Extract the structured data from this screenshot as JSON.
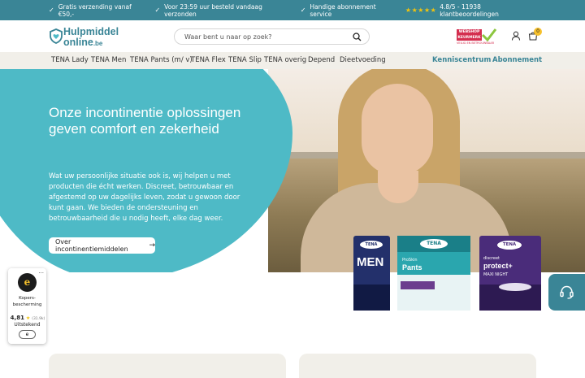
{
  "topbar": {
    "usps": [
      "Gratis verzending vanaf €50,-",
      "Voor 23:59 uur besteld vandaag verzonden",
      "Handige abonnement service"
    ],
    "stars": "★★★★★",
    "rating": "4.8/5 - 11938 klantbeoordelingen"
  },
  "header": {
    "logo_line1": "Hulpmiddel",
    "logo_line2": "online",
    "logo_tld": ".be",
    "search_placeholder": "Waar bent u naar op zoek?",
    "keurmerk_line1": "WEBSHOP",
    "keurmerk_line2": "KEURMERK",
    "keurmerk_sub": "VEILIG EN BETROUWBAAR",
    "cart_count": "0"
  },
  "nav": {
    "items": [
      "TENA Lady",
      "TENA Men",
      "TENA Pants (m/ v)",
      "TENA Flex",
      "TENA Slip",
      "TENA overig",
      "Depend",
      "Dieetvoeding"
    ],
    "right": [
      "Kenniscentrum",
      "Abonnement"
    ]
  },
  "hero": {
    "title": "Onze incontinentie oplossingen geven comfort en zekerheid",
    "text": "Wat uw persoonlijke situatie ook is, wij helpen u met producten die écht werken. Discreet, betrouwbaar en afgestemd op uw dagelijks leven, zodat u gewoon door kunt gaan. We bieden de ondersteuning en betrouwbaarheid die u nodig heeft, elke dag weer.",
    "button": "Over incontinentiemiddelen",
    "button_arrow": "→"
  },
  "products": {
    "men": {
      "brand": "TENA",
      "label": "MEN"
    },
    "pants": {
      "brand": "TENA",
      "sub": "ProSkin",
      "label": "Pants"
    },
    "discreet": {
      "brand": "TENA",
      "sub": "discreet",
      "label": "protect+",
      "variant": "MAXI NIGHT"
    }
  },
  "badge": {
    "dots": "...",
    "seal": "e",
    "label": "Kopers-bescherming",
    "score": "4,81",
    "star": "★",
    "count": "(31.9k)",
    "verdict": "Uitstekend",
    "mini": "e"
  },
  "colors": {
    "brand_teal": "#3a8596",
    "hero_blob": "#4ebac6",
    "nav_bg": "#f1efe9",
    "cart_badge": "#f6c02c"
  }
}
